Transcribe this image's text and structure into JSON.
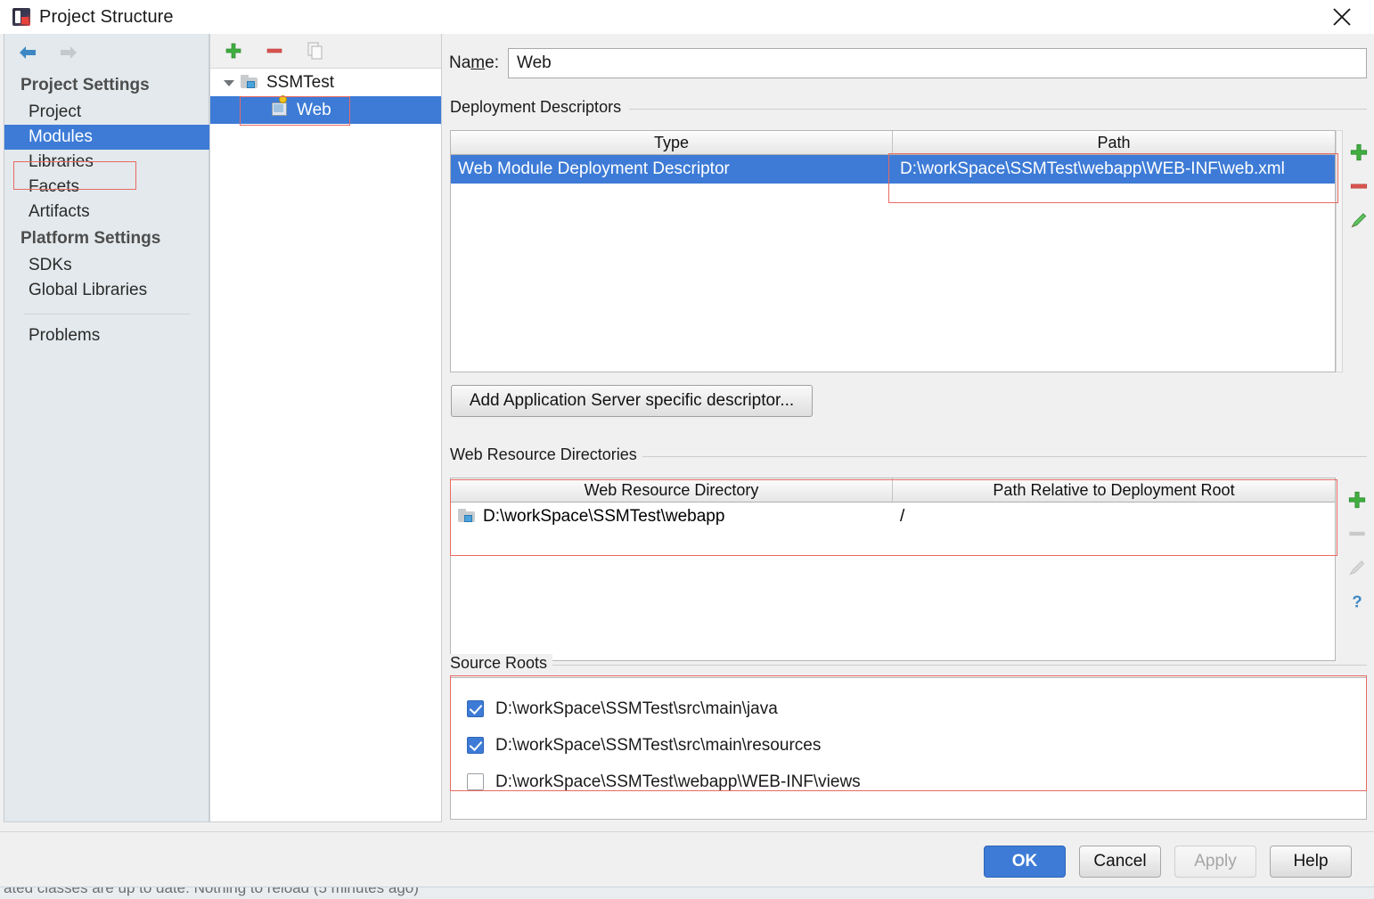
{
  "window": {
    "title": "Project Structure",
    "app_icon": "intellij-idea-icon",
    "close_icon": "close-icon"
  },
  "sidebar": {
    "back_icon": "back-arrow-icon",
    "forward_icon": "forward-arrow-icon",
    "groups": [
      {
        "header": "Project Settings",
        "items": [
          {
            "label": "Project",
            "selected": false
          },
          {
            "label": "Modules",
            "selected": true
          },
          {
            "label": "Libraries",
            "selected": false
          },
          {
            "label": "Facets",
            "selected": false
          },
          {
            "label": "Artifacts",
            "selected": false
          }
        ]
      },
      {
        "header": "Platform Settings",
        "items": [
          {
            "label": "SDKs",
            "selected": false
          },
          {
            "label": "Global Libraries",
            "selected": false
          }
        ]
      }
    ],
    "extra_items": [
      {
        "label": "Problems",
        "selected": false
      }
    ]
  },
  "tree_panel": {
    "toolbar": [
      {
        "name": "add-module-button",
        "icon": "plus-icon",
        "enabled": true
      },
      {
        "name": "remove-module-button",
        "icon": "minus-icon",
        "enabled": true
      },
      {
        "name": "copy-module-button",
        "icon": "copy-icon",
        "enabled": false
      }
    ],
    "nodes": [
      {
        "label": "SSMTest",
        "icon": "folder-icon",
        "depth": 0,
        "expanded": true,
        "selected": false
      },
      {
        "label": "Web",
        "icon": "web-module-icon",
        "depth": 1,
        "expanded": false,
        "selected": true
      }
    ]
  },
  "detail": {
    "name_field": {
      "label": "Name:",
      "label_mnemonic": "m",
      "value": "Web",
      "placeholder": ""
    },
    "deployment_descriptors": {
      "section_title": "Deployment Descriptors",
      "columns": [
        "Type",
        "Path"
      ],
      "rows": [
        {
          "type": "Web Module Deployment Descriptor",
          "path": "D:\\workSpace\\SSMTest\\webapp\\WEB-INF\\web.xml",
          "selected": true
        }
      ],
      "tools": [
        {
          "name": "add-descriptor-button",
          "icon": "plus-icon",
          "enabled": true
        },
        {
          "name": "remove-descriptor-button",
          "icon": "minus-icon",
          "enabled": true
        },
        {
          "name": "edit-descriptor-button",
          "icon": "pencil-icon",
          "enabled": true
        }
      ],
      "add_button_label": "Add Application Server specific descriptor..."
    },
    "web_resource_directories": {
      "section_title": "Web Resource Directories",
      "columns": [
        "Web Resource Directory",
        "Path Relative to Deployment Root"
      ],
      "rows": [
        {
          "directory": "D:\\workSpace\\SSMTest\\webapp",
          "relative_path": "/",
          "icon": "folder-icon",
          "selected": false
        }
      ],
      "tools": [
        {
          "name": "add-web-resource-button",
          "icon": "plus-icon",
          "enabled": true
        },
        {
          "name": "remove-web-resource-button",
          "icon": "minus-icon",
          "enabled": false
        },
        {
          "name": "edit-web-resource-button",
          "icon": "pencil-icon",
          "enabled": false
        },
        {
          "name": "help-web-resource-button",
          "icon": "question-mark-icon",
          "enabled": true
        }
      ]
    },
    "source_roots": {
      "section_title": "Source Roots",
      "items": [
        {
          "label": "D:\\workSpace\\SSMTest\\src\\main\\java",
          "checked": true
        },
        {
          "label": "D:\\workSpace\\SSMTest\\src\\main\\resources",
          "checked": true
        },
        {
          "label": "D:\\workSpace\\SSMTest\\webapp\\WEB-INF\\views",
          "checked": false
        }
      ]
    }
  },
  "footer": {
    "ok_label": "OK",
    "cancel_label": "Cancel",
    "apply_label": "Apply",
    "apply_enabled": false,
    "help_label": "Help"
  },
  "status_bar": {
    "text": "ated classes are up to date. Nothing to reload (5 minutes ago)"
  },
  "colors": {
    "selection_blue": "#3d7bd6",
    "annotation_red": "#e86a63",
    "panel_bg": "#f0f0f0",
    "sidebar_bg": "#e3e9ec"
  }
}
